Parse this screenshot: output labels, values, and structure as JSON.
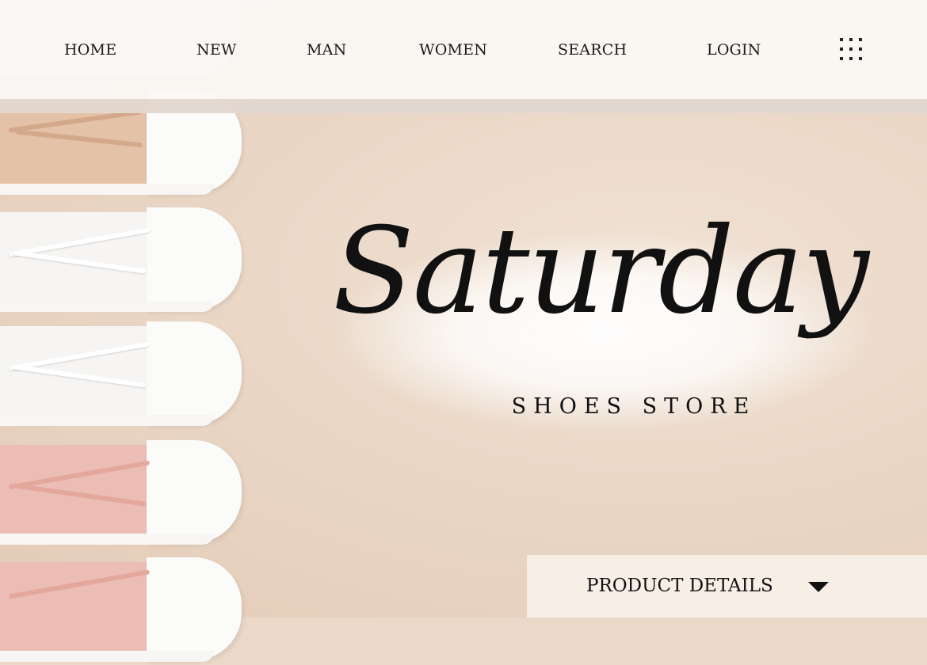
{
  "nav": {
    "items": [
      {
        "label": "HOME"
      },
      {
        "label": "NEW"
      },
      {
        "label": "MAN"
      },
      {
        "label": "WOMEN"
      },
      {
        "label": "SEARCH"
      },
      {
        "label": "LOGIN"
      }
    ],
    "menu_icon": "grid-menu-icon"
  },
  "hero": {
    "title": "Saturday",
    "subtitle": "SHOES STORE"
  },
  "details": {
    "label": "PRODUCT DETAILS",
    "icon": "caret-down-icon"
  },
  "colors": {
    "background": "#ead8c8",
    "nav_bg": "#faf7f4",
    "text": "#111111",
    "shoe_tan": "#e2bfa5",
    "shoe_white": "#f4f2ef",
    "shoe_pink": "#ebbcb4"
  }
}
